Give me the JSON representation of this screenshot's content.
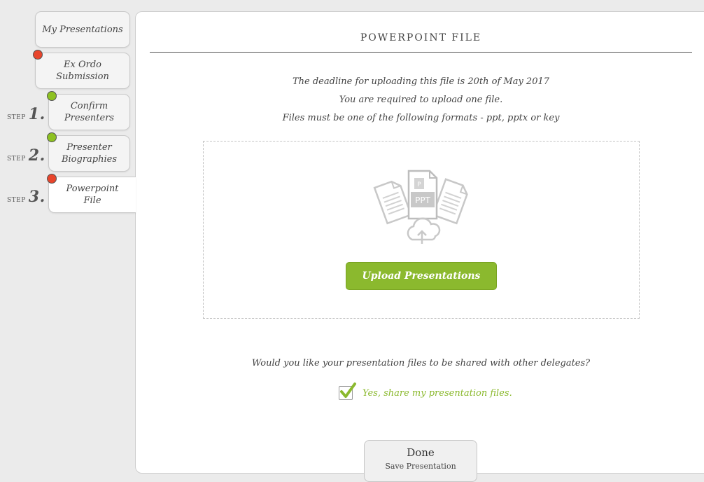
{
  "nav": {
    "tabs": [
      {
        "label": "My Presentations"
      },
      {
        "label_line1": "Ex Ordo",
        "label_line2": "Submission",
        "status": "red"
      },
      {
        "label_line1": "Confirm",
        "label_line2": "Presenters",
        "status": "green",
        "step_label": "STEP",
        "step_number": "1."
      },
      {
        "label_line1": "Presenter",
        "label_line2": "Biographies",
        "status": "green",
        "step_label": "STEP",
        "step_number": "2."
      },
      {
        "label_line1": "Powerpoint",
        "label_line2": "File",
        "status": "red",
        "step_label": "STEP",
        "step_number": "3.",
        "active": true
      }
    ]
  },
  "panel": {
    "title": "POWERPOINT FILE",
    "deadline_text": "The deadline for uploading this file is 20th of May 2017",
    "requirement_text": "You are required to upload one file.",
    "formats_text": "Files must be one of the following formats - ppt, pptx or key",
    "dropzone": {
      "icon_text": "PPT",
      "upload_button_label": "Upload Presentations"
    },
    "share_question": "Would you like your presentation files to be shared with other delegates?",
    "share_checkbox_label": "Yes, share my presentation files.",
    "share_checked": true
  },
  "footer": {
    "done_label": "Done",
    "done_sublabel": "Save Presentation"
  },
  "colors": {
    "accent_green": "#8bb92e",
    "status_red": "#e8452c",
    "status_green": "#8dc121"
  }
}
